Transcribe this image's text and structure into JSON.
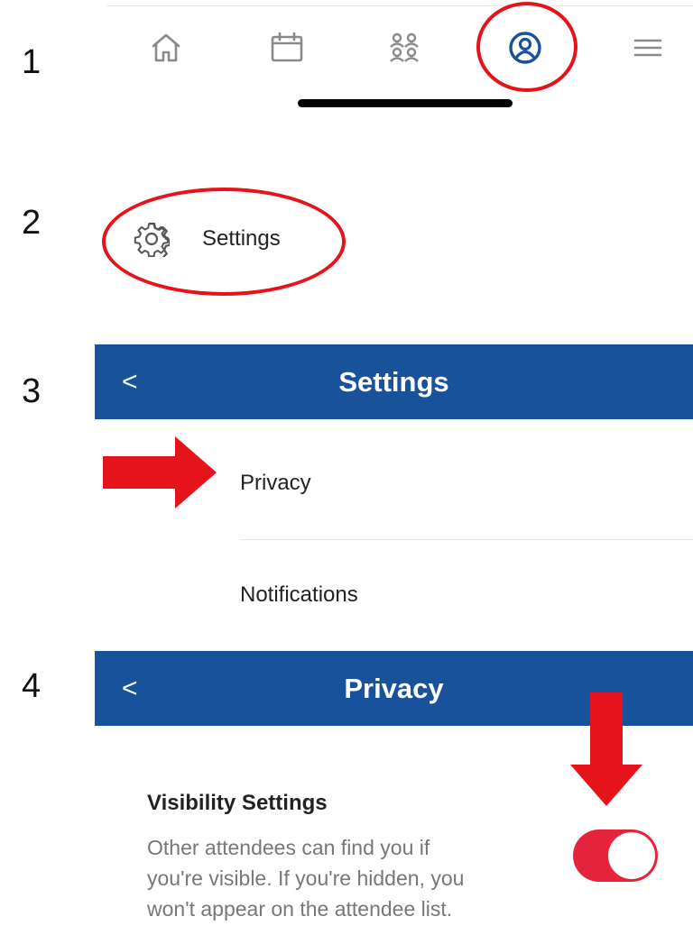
{
  "steps": [
    "1",
    "2",
    "3",
    "4"
  ],
  "tabbar": {
    "icons": [
      "home-icon",
      "calendar-icon",
      "people-icon",
      "profile-icon",
      "menu-icon"
    ],
    "active_color": "#17529b",
    "inactive_color": "#8a8a8a"
  },
  "menu": {
    "settings_label": "Settings",
    "icon": "gear-icon"
  },
  "settings_screen": {
    "title": "Settings",
    "back": "<",
    "items": [
      "Privacy",
      "Notifications"
    ]
  },
  "privacy_screen": {
    "title": "Privacy",
    "back": "<",
    "visibility_title": "Visibility Settings",
    "visibility_desc": "Other attendees can find you if you're visible. If you're hidden, you won't appear on the attendee list.",
    "visible_toggle_on": true
  },
  "colors": {
    "header_blue": "#17529b",
    "annotation_red": "#e5141b",
    "toggle_red": "#e5243b"
  }
}
